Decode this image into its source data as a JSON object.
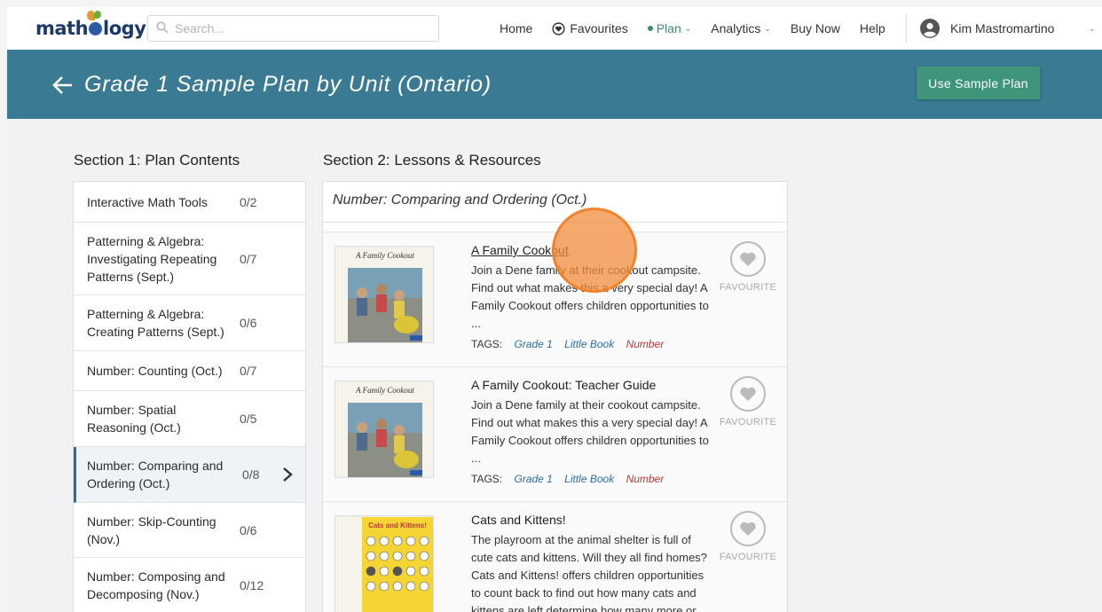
{
  "nav": {
    "logo_prefix": "math",
    "logo_suffix": "logy",
    "search_placeholder": "Search...",
    "home": "Home",
    "favourites": "Favourites",
    "plan": "Plan",
    "analytics": "Analytics",
    "buy_now": "Buy Now",
    "help": "Help",
    "user_name": "Kim Mastromartino",
    "caret": "⌄",
    "accent_color": "#3a8f72"
  },
  "banner": {
    "title": "Grade 1 Sample Plan by Unit (Ontario)",
    "use_button": "Use Sample Plan",
    "background_color": "#3a7a93",
    "button_color": "#3e9579"
  },
  "section1": {
    "title": "Section 1: Plan Contents",
    "items": [
      {
        "label": "Interactive Math Tools",
        "count": "0/2"
      },
      {
        "label": "Patterning & Algebra: Investigating Repeating Patterns (Sept.)",
        "count": "0/7"
      },
      {
        "label": "Patterning & Algebra: Creating Patterns (Sept.)",
        "count": "0/6"
      },
      {
        "label": "Number: Counting (Oct.)",
        "count": "0/7"
      },
      {
        "label": "Number: Spatial Reasoning (Oct.)",
        "count": "0/5"
      },
      {
        "label": "Number: Comparing and Ordering (Oct.)",
        "count": "0/8",
        "selected": true
      },
      {
        "label": "Number: Skip-Counting (Nov.)",
        "count": "0/6"
      },
      {
        "label": "Number: Composing and Decomposing (Nov.)",
        "count": "0/12"
      }
    ]
  },
  "section2": {
    "title": "Section 2: Lessons & Resources",
    "unit_title": "Number: Comparing and Ordering (Oct.)",
    "favourite_label": "FAVOURITE",
    "tags_label": "TAGS:",
    "cards": [
      {
        "title": "A Family Cookout",
        "description": "Join a Dene family at their cookout campsite. Find out what makes this a very special day! A Family Cookout offers children opportunities to ...",
        "tags": [
          "Grade 1",
          "Little Book",
          "Number"
        ],
        "thumb_title": "A Family Cookout"
      },
      {
        "title": "A Family Cookout: Teacher Guide",
        "description": "Join a Dene family at their cookout campsite. Find out what makes this a very special day! A Family Cookout offers children opportunities to ...",
        "tags": [
          "Grade 1",
          "Little Book",
          "Number"
        ],
        "thumb_title": "A Family Cookout"
      },
      {
        "title": "Cats and Kittens!",
        "description": "The playroom at the animal shelter is full of cute cats and kittens. Will they all find homes? Cats and Kittens! offers children opportunities to count back to find out how many cats and kittens are left determine how many more or",
        "tags": [],
        "thumb_title": "Cats and Kittens!"
      }
    ]
  }
}
